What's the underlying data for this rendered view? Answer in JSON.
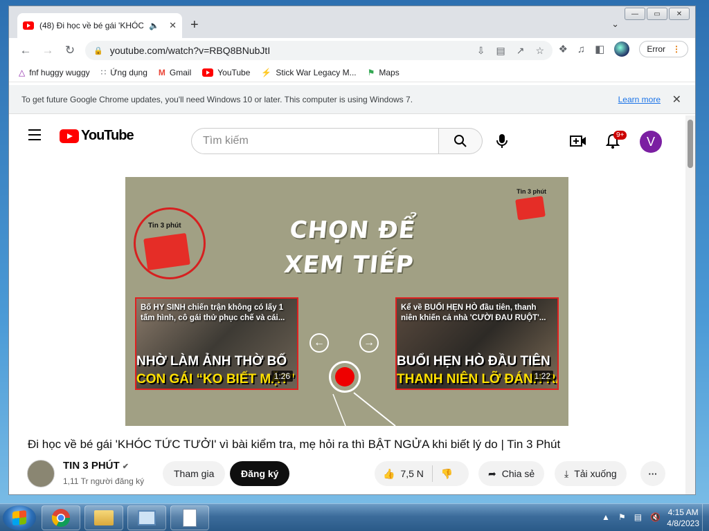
{
  "browser": {
    "tab": {
      "title": "(48) Đi học về bé gái 'KHÓC",
      "close": "✕"
    },
    "new_tab": "+",
    "tab_search": "⌄",
    "window_controls": {
      "minimize": "—",
      "restore": "▭",
      "close": "✕"
    },
    "url": "youtube.com/watch?v=RBQ8BNubJtI",
    "error_label": "Error",
    "bookmarks": [
      {
        "label": "fnf huggy wuggy",
        "icon": "triangle-icon",
        "color": "#8e24aa"
      },
      {
        "label": "Ứng dụng",
        "icon": "apps-grid-icon",
        "color": "#5f6368"
      },
      {
        "label": "Gmail",
        "icon": "gmail-icon",
        "color": "#ea4335"
      },
      {
        "label": "YouTube",
        "icon": "youtube-icon",
        "color": "#ff0000"
      },
      {
        "label": "Stick War Legacy M...",
        "icon": "stick-war-icon",
        "color": "#1e8e3e"
      },
      {
        "label": "Maps",
        "icon": "maps-icon",
        "color": "#34a853"
      }
    ],
    "infobar": {
      "message": "To get future Google Chrome updates, you'll need Windows 10 or later. This computer is using Windows 7.",
      "link": "Learn more",
      "close": "✕"
    }
  },
  "youtube": {
    "logo_text": "YouTube",
    "search_placeholder": "Tìm kiếm",
    "notifications_badge": "9+",
    "avatar_letter": "V",
    "player": {
      "heading_line1": "CHỌN ĐỂ",
      "heading_line2": "XEM TIẾP",
      "logo_label": "Tin 3 phút",
      "left_video": {
        "title": "Bố HY SINH chiến trận không có lấy 1 tấm hình, cô gái thử phục chế và cái...",
        "caption1": "NHỜ LÀM ẢNH THỜ BỐ",
        "caption2": "CON GÁI “KO BIẾT MẶT”",
        "duration": "1:26"
      },
      "right_video": {
        "title": "Kể về BUỔI HẸN HÒ đầu tiên, thanh niên khiến cả nhà 'CƯỜI ĐAU RUỘT'...",
        "caption1": "BUỔI HẸN HÒ ĐẦU TIÊN",
        "caption2": "THANH NIÊN LỠ ĐÁNH RẮM",
        "duration": "1:22"
      }
    },
    "video_title": "Đi học về bé gái 'KHÓC TỨC TƯỞI' vì bài kiểm tra, mẹ hỏi ra thì BẬT NGỬA khi biết lý do | Tin 3 Phút",
    "channel": {
      "name": "TIN 3 PHÚT",
      "verified": "✔",
      "subscribers": "1,11 Tr người đăng ký"
    },
    "buttons": {
      "join": "Tham gia",
      "subscribe": "Đăng ký",
      "likes": "7,5 N",
      "share": "Chia sẻ",
      "download": "Tải xuống",
      "more": "···"
    }
  },
  "taskbar": {
    "time": "4:15 AM",
    "date": "4/8/2023"
  },
  "colors": {
    "accent_red": "#ff0000",
    "chrome_bg": "#dee1e6",
    "link_blue": "#1a73e8",
    "avatar_purple": "#7b1fa2"
  }
}
